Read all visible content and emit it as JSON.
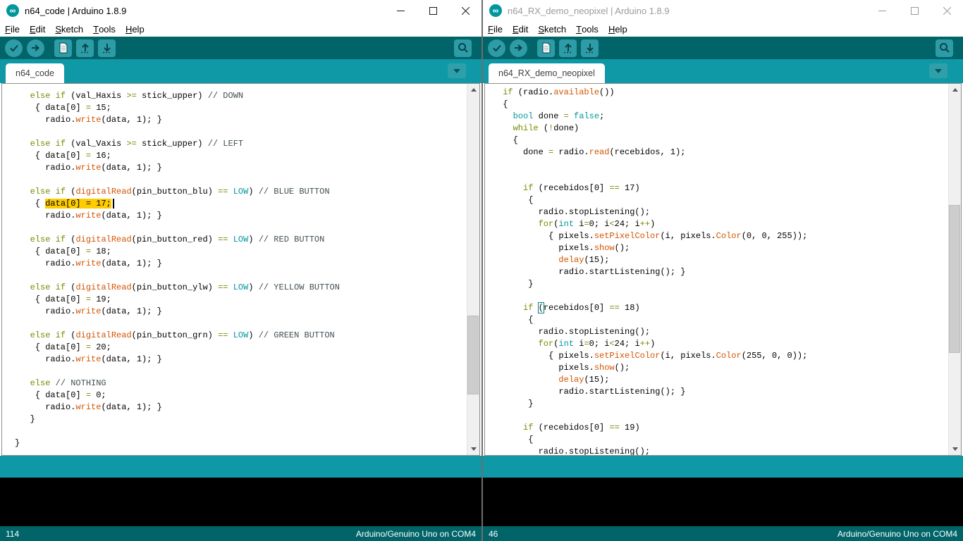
{
  "colors": {
    "toolbar_bg": "#006468",
    "tabstrip_bg": "#0f98a5",
    "statusband_bg": "#0f98a5",
    "linestatus_bg": "#006468",
    "console_bg": "#000000",
    "button_fill": "#2e9ca6",
    "keyword": "#728e00",
    "function": "#d35400",
    "datatype": "#00979c",
    "comment": "#434f54",
    "selection_bg": "#ffcc00",
    "brand_teal": "#00979c"
  },
  "left": {
    "title": "n64_code | Arduino 1.8.9",
    "menu": [
      {
        "pre": "F",
        "rest": "ile"
      },
      {
        "pre": "E",
        "rest": "dit"
      },
      {
        "pre": "S",
        "rest": "ketch"
      },
      {
        "pre": "T",
        "rest": "ools"
      },
      {
        "pre": "H",
        "rest": "elp"
      }
    ],
    "toolbar_icons": [
      "verify-icon",
      "upload-icon",
      "new-sketch-icon",
      "open-icon",
      "save-icon",
      "serial-monitor-icon"
    ],
    "tab": "n64_code",
    "status_line_number": "114",
    "board_status": "Arduino/Genuino Uno on COM4",
    "code": [
      [
        [
          "p",
          "   "
        ],
        [
          "k",
          "else"
        ],
        [
          "p",
          " "
        ],
        [
          "k",
          "if"
        ],
        [
          "p",
          " (val_Haxis "
        ],
        [
          "k",
          ">="
        ],
        [
          "p",
          " stick_upper) "
        ],
        [
          "c",
          "// DOWN"
        ]
      ],
      [
        [
          "p",
          "    { data[0] "
        ],
        [
          "k",
          "="
        ],
        [
          "p",
          " 15;"
        ]
      ],
      [
        [
          "p",
          "      radio."
        ],
        [
          "f",
          "write"
        ],
        [
          "p",
          "(data, 1); }"
        ]
      ],
      [],
      [
        [
          "p",
          "   "
        ],
        [
          "k",
          "else"
        ],
        [
          "p",
          " "
        ],
        [
          "k",
          "if"
        ],
        [
          "p",
          " (val_Vaxis "
        ],
        [
          "k",
          ">="
        ],
        [
          "p",
          " stick_upper) "
        ],
        [
          "c",
          "// LEFT"
        ]
      ],
      [
        [
          "p",
          "    { data[0] "
        ],
        [
          "k",
          "="
        ],
        [
          "p",
          " 16;"
        ]
      ],
      [
        [
          "p",
          "      radio."
        ],
        [
          "f",
          "write"
        ],
        [
          "p",
          "(data, 1); }"
        ]
      ],
      [],
      [
        [
          "p",
          "   "
        ],
        [
          "k",
          "else"
        ],
        [
          "p",
          " "
        ],
        [
          "k",
          "if"
        ],
        [
          "p",
          " ("
        ],
        [
          "f",
          "digitalRead"
        ],
        [
          "p",
          "(pin_button_blu) "
        ],
        [
          "k",
          "=="
        ],
        [
          "p",
          " "
        ],
        [
          "t",
          "LOW"
        ],
        [
          "p",
          ") "
        ],
        [
          "c",
          "// BLUE BUTTON"
        ]
      ],
      [
        [
          "p",
          "    { "
        ],
        [
          "s",
          "data[0] = 17;"
        ],
        [
          "x",
          ""
        ]
      ],
      [
        [
          "p",
          "      radio."
        ],
        [
          "f",
          "write"
        ],
        [
          "p",
          "(data, 1); }"
        ]
      ],
      [],
      [
        [
          "p",
          "   "
        ],
        [
          "k",
          "else"
        ],
        [
          "p",
          " "
        ],
        [
          "k",
          "if"
        ],
        [
          "p",
          " ("
        ],
        [
          "f",
          "digitalRead"
        ],
        [
          "p",
          "(pin_button_red) "
        ],
        [
          "k",
          "=="
        ],
        [
          "p",
          " "
        ],
        [
          "t",
          "LOW"
        ],
        [
          "p",
          ") "
        ],
        [
          "c",
          "// RED BUTTON"
        ]
      ],
      [
        [
          "p",
          "    { data[0] "
        ],
        [
          "k",
          "="
        ],
        [
          "p",
          " 18;"
        ]
      ],
      [
        [
          "p",
          "      radio."
        ],
        [
          "f",
          "write"
        ],
        [
          "p",
          "(data, 1); }"
        ]
      ],
      [],
      [
        [
          "p",
          "   "
        ],
        [
          "k",
          "else"
        ],
        [
          "p",
          " "
        ],
        [
          "k",
          "if"
        ],
        [
          "p",
          " ("
        ],
        [
          "f",
          "digitalRead"
        ],
        [
          "p",
          "(pin_button_ylw) "
        ],
        [
          "k",
          "=="
        ],
        [
          "p",
          " "
        ],
        [
          "t",
          "LOW"
        ],
        [
          "p",
          ") "
        ],
        [
          "c",
          "// YELLOW BUTTON"
        ]
      ],
      [
        [
          "p",
          "    { data[0] "
        ],
        [
          "k",
          "="
        ],
        [
          "p",
          " 19;"
        ]
      ],
      [
        [
          "p",
          "      radio."
        ],
        [
          "f",
          "write"
        ],
        [
          "p",
          "(data, 1); }"
        ]
      ],
      [],
      [
        [
          "p",
          "   "
        ],
        [
          "k",
          "else"
        ],
        [
          "p",
          " "
        ],
        [
          "k",
          "if"
        ],
        [
          "p",
          " ("
        ],
        [
          "f",
          "digitalRead"
        ],
        [
          "p",
          "(pin_button_grn) "
        ],
        [
          "k",
          "=="
        ],
        [
          "p",
          " "
        ],
        [
          "t",
          "LOW"
        ],
        [
          "p",
          ") "
        ],
        [
          "c",
          "// GREEN BUTTON"
        ]
      ],
      [
        [
          "p",
          "    { data[0] "
        ],
        [
          "k",
          "="
        ],
        [
          "p",
          " 20;"
        ]
      ],
      [
        [
          "p",
          "      radio."
        ],
        [
          "f",
          "write"
        ],
        [
          "p",
          "(data, 1); }"
        ]
      ],
      [],
      [
        [
          "p",
          "   "
        ],
        [
          "k",
          "else"
        ],
        [
          "p",
          " "
        ],
        [
          "c",
          "// NOTHING"
        ]
      ],
      [
        [
          "p",
          "    { data[0] "
        ],
        [
          "k",
          "="
        ],
        [
          "p",
          " 0;"
        ]
      ],
      [
        [
          "p",
          "      radio."
        ],
        [
          "f",
          "write"
        ],
        [
          "p",
          "(data, 1); }"
        ]
      ],
      [
        [
          "p",
          "   }"
        ]
      ],
      [],
      [
        [
          "p",
          "}"
        ]
      ]
    ]
  },
  "right": {
    "title": "n64_RX_demo_neopixel | Arduino 1.8.9",
    "menu": [
      {
        "pre": "F",
        "rest": "ile"
      },
      {
        "pre": "E",
        "rest": "dit"
      },
      {
        "pre": "S",
        "rest": "ketch"
      },
      {
        "pre": "T",
        "rest": "ools"
      },
      {
        "pre": "H",
        "rest": "elp"
      }
    ],
    "toolbar_icons": [
      "verify-icon",
      "upload-icon",
      "new-sketch-icon",
      "open-icon",
      "save-icon",
      "serial-monitor-icon"
    ],
    "tab": "n64_RX_demo_neopixel",
    "status_line_number": "46",
    "board_status": "Arduino/Genuino Uno on COM4",
    "code": [
      [
        [
          "p",
          " "
        ],
        [
          "k",
          "if"
        ],
        [
          "p",
          " (radio."
        ],
        [
          "f",
          "available"
        ],
        [
          "p",
          "())"
        ]
      ],
      [
        [
          "p",
          " {"
        ]
      ],
      [
        [
          "p",
          "   "
        ],
        [
          "t",
          "bool"
        ],
        [
          "p",
          " done "
        ],
        [
          "k",
          "="
        ],
        [
          "p",
          " "
        ],
        [
          "t",
          "false"
        ],
        [
          "p",
          ";"
        ]
      ],
      [
        [
          "p",
          "   "
        ],
        [
          "k",
          "while"
        ],
        [
          "p",
          " ("
        ],
        [
          "k",
          "!"
        ],
        [
          "p",
          "done)"
        ]
      ],
      [
        [
          "p",
          "   {"
        ]
      ],
      [
        [
          "p",
          "     done "
        ],
        [
          "k",
          "="
        ],
        [
          "p",
          " radio."
        ],
        [
          "f",
          "read"
        ],
        [
          "p",
          "(recebidos, 1);"
        ]
      ],
      [],
      [],
      [
        [
          "p",
          "     "
        ],
        [
          "k",
          "if"
        ],
        [
          "p",
          " (recebidos[0] "
        ],
        [
          "k",
          "=="
        ],
        [
          "p",
          " 17)"
        ]
      ],
      [
        [
          "p",
          "      {"
        ]
      ],
      [
        [
          "p",
          "        radio.stopListening();"
        ]
      ],
      [
        [
          "p",
          "        "
        ],
        [
          "k",
          "for"
        ],
        [
          "p",
          "("
        ],
        [
          "t",
          "int"
        ],
        [
          "p",
          " i"
        ],
        [
          "k",
          "="
        ],
        [
          "p",
          "0; i"
        ],
        [
          "k",
          "<"
        ],
        [
          "p",
          "24; i"
        ],
        [
          "k",
          "++"
        ],
        [
          "p",
          ")"
        ]
      ],
      [
        [
          "p",
          "          { pixels."
        ],
        [
          "f",
          "setPixelColor"
        ],
        [
          "p",
          "(i, pixels."
        ],
        [
          "f",
          "Color"
        ],
        [
          "p",
          "(0, 0, 255));"
        ]
      ],
      [
        [
          "p",
          "            pixels."
        ],
        [
          "f",
          "show"
        ],
        [
          "p",
          "();"
        ]
      ],
      [
        [
          "p",
          "            "
        ],
        [
          "f",
          "delay"
        ],
        [
          "p",
          "(15);"
        ]
      ],
      [
        [
          "p",
          "            radio.startListening(); }"
        ]
      ],
      [
        [
          "p",
          "      }"
        ]
      ],
      [],
      [
        [
          "p",
          "     "
        ],
        [
          "k",
          "if"
        ],
        [
          "p",
          " "
        ],
        [
          "b",
          "("
        ],
        [
          "p",
          "recebidos[0] "
        ],
        [
          "k",
          "=="
        ],
        [
          "p",
          " 18)"
        ]
      ],
      [
        [
          "p",
          "      {"
        ]
      ],
      [
        [
          "p",
          "        radio.stopListening();"
        ]
      ],
      [
        [
          "p",
          "        "
        ],
        [
          "k",
          "for"
        ],
        [
          "p",
          "("
        ],
        [
          "t",
          "int"
        ],
        [
          "p",
          " i"
        ],
        [
          "k",
          "="
        ],
        [
          "p",
          "0; i"
        ],
        [
          "k",
          "<"
        ],
        [
          "p",
          "24; i"
        ],
        [
          "k",
          "++"
        ],
        [
          "p",
          ")"
        ]
      ],
      [
        [
          "p",
          "          { pixels."
        ],
        [
          "f",
          "setPixelColor"
        ],
        [
          "p",
          "(i, pixels."
        ],
        [
          "f",
          "Color"
        ],
        [
          "p",
          "(255, 0, 0));"
        ]
      ],
      [
        [
          "p",
          "            pixels."
        ],
        [
          "f",
          "show"
        ],
        [
          "p",
          "();"
        ]
      ],
      [
        [
          "p",
          "            "
        ],
        [
          "f",
          "delay"
        ],
        [
          "p",
          "(15);"
        ]
      ],
      [
        [
          "p",
          "            radio.startListening(); }"
        ]
      ],
      [
        [
          "p",
          "      }"
        ]
      ],
      [],
      [
        [
          "p",
          "     "
        ],
        [
          "k",
          "if"
        ],
        [
          "p",
          " (recebidos[0] "
        ],
        [
          "k",
          "=="
        ],
        [
          "p",
          " 19)"
        ]
      ],
      [
        [
          "p",
          "      {"
        ]
      ],
      [
        [
          "p",
          "        radio.stopListening();"
        ]
      ]
    ]
  }
}
